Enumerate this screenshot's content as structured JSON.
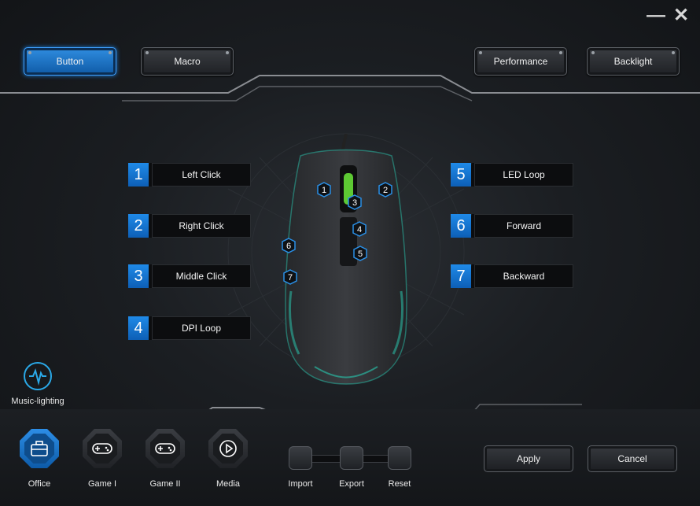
{
  "window": {
    "minimize_glyph": "—",
    "close_glyph": "✕"
  },
  "top_tabs": {
    "button": "Button",
    "macro": "Macro",
    "performance": "Performance",
    "backlight": "Backlight"
  },
  "assignments": [
    {
      "num": "1",
      "label": "Left Click"
    },
    {
      "num": "2",
      "label": "Right Click"
    },
    {
      "num": "3",
      "label": "Middle Click"
    },
    {
      "num": "4",
      "label": "DPI Loop"
    },
    {
      "num": "5",
      "label": "LED Loop"
    },
    {
      "num": "6",
      "label": "Forward"
    },
    {
      "num": "7",
      "label": "Backward"
    }
  ],
  "mouse_markers": [
    "1",
    "2",
    "3",
    "4",
    "5",
    "6",
    "7"
  ],
  "music_lighting": {
    "label": "Music-lighting",
    "icon": "waveform-icon"
  },
  "modes": [
    {
      "label": "Office",
      "icon": "briefcase-icon",
      "active": true
    },
    {
      "label": "Game I",
      "icon": "gamepad-icon"
    },
    {
      "label": "Game II",
      "icon": "gamepad-icon"
    },
    {
      "label": "Media",
      "icon": "play-icon"
    }
  ],
  "tools": [
    {
      "label": "Import",
      "icon": "import-icon"
    },
    {
      "label": "Export",
      "icon": "export-icon"
    },
    {
      "label": "Reset",
      "icon": "reset-icon"
    }
  ],
  "actions": {
    "apply": "Apply",
    "cancel": "Cancel"
  },
  "colors": {
    "accent": "#1b7bd6",
    "glow": "#2ab5a0",
    "wheel": "#6bea3a"
  }
}
